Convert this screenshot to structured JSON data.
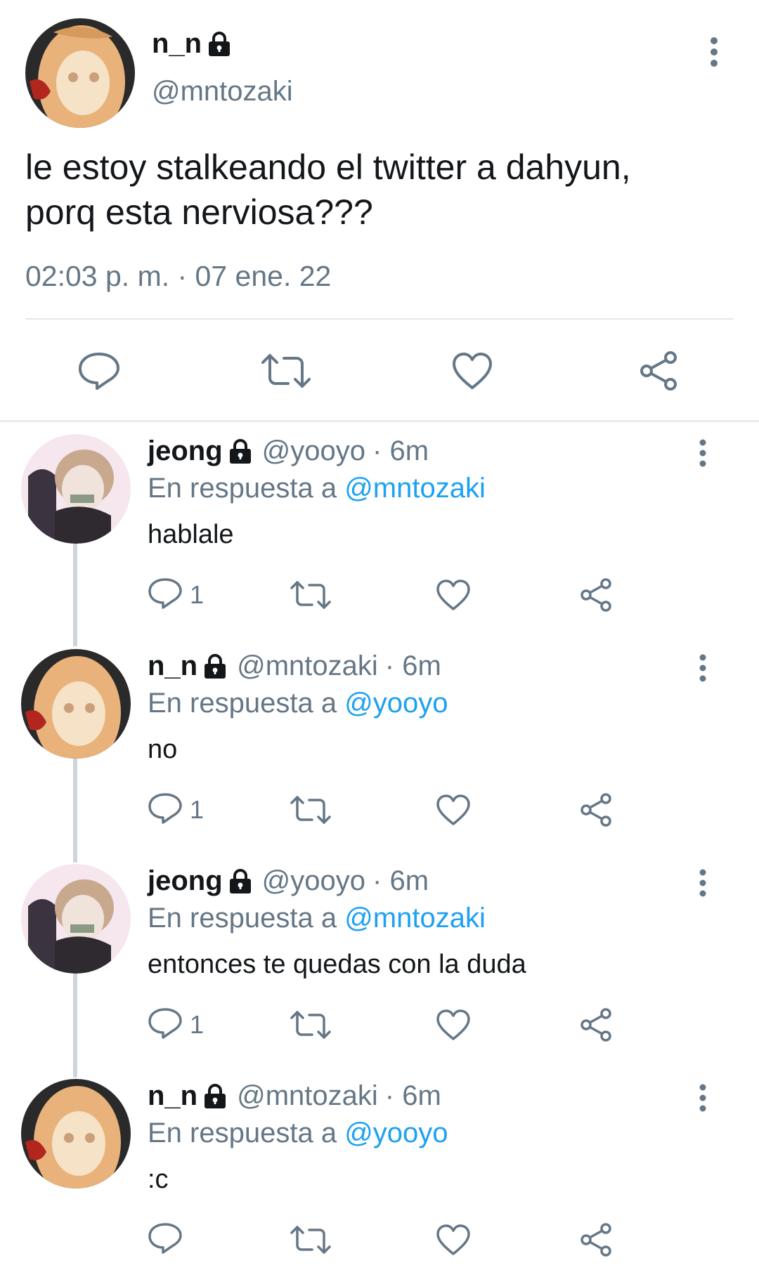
{
  "tweet": {
    "display_name": "n_n",
    "handle": "@mntozaki",
    "text_line1": "le estoy stalkeando el twitter a dahyun,",
    "text_line2": "porq esta nerviosa???",
    "timestamp": "02:03 p. m. · 07 ene. 22",
    "icons": [
      "lock-icon",
      "more-icon",
      "reply-icon",
      "retweet-icon",
      "like-icon",
      "share-icon"
    ]
  },
  "replies": [
    {
      "display_name": "jeong",
      "handle": "@yooyo",
      "time": "· 6m",
      "reply_prefix": "En respuesta a ",
      "reply_to": "@mntozaki",
      "text": "hablale",
      "reply_count": "1",
      "avatar": "avatar-jeong"
    },
    {
      "display_name": "n_n",
      "handle": "@mntozaki",
      "time": "· 6m",
      "reply_prefix": "En respuesta a ",
      "reply_to": "@yooyo",
      "text": "no",
      "reply_count": "1",
      "avatar": "avatar-nn"
    },
    {
      "display_name": "jeong",
      "handle": "@yooyo",
      "time": "· 6m",
      "reply_prefix": "En respuesta a ",
      "reply_to": "@mntozaki",
      "text": "entonces te quedas con la duda",
      "reply_count": "1",
      "avatar": "avatar-jeong"
    },
    {
      "display_name": "n_n",
      "handle": "@mntozaki",
      "time": "· 6m",
      "reply_prefix": "En respuesta a ",
      "reply_to": "@yooyo",
      "text": ":c",
      "reply_count": "",
      "avatar": "avatar-nn"
    }
  ],
  "colors": {
    "text": "#14171a",
    "secondary": "#657786",
    "link": "#1da1f2",
    "divider": "#e1e8ed",
    "thread_line": "#ccd6dd"
  }
}
